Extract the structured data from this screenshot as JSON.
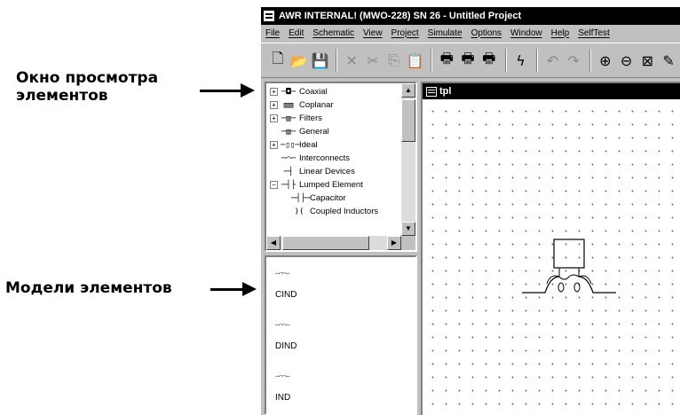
{
  "annotations": {
    "browser_label": "Окно просмотра\nэлементов",
    "models_label": "Модели элементов"
  },
  "window": {
    "title": "AWR INTERNAL! (MWO-228) SN 26 - Untitled Project"
  },
  "menu": [
    "File",
    "Edit",
    "Schematic",
    "View",
    "Project",
    "Simulate",
    "Options",
    "Window",
    "Help",
    "SelfTest"
  ],
  "toolbar": {
    "buttons": [
      {
        "icon": "new-document-icon",
        "glyph": "🗋",
        "enabled": true
      },
      {
        "icon": "open-folder-icon",
        "glyph": "📂",
        "enabled": true
      },
      {
        "icon": "save-icon",
        "glyph": "💾",
        "enabled": true
      },
      {
        "icon": "delete-icon",
        "glyph": "✕",
        "enabled": false
      },
      {
        "icon": "cut-icon",
        "glyph": "✂",
        "enabled": false
      },
      {
        "icon": "copy-icon",
        "glyph": "⎘",
        "enabled": false
      },
      {
        "icon": "paste-icon",
        "glyph": "📋",
        "enabled": true
      },
      {
        "icon": "print-icon",
        "glyph": "🖶",
        "enabled": true
      },
      {
        "icon": "print-preview-icon",
        "glyph": "🖶",
        "enabled": true
      },
      {
        "icon": "print-setup-icon",
        "glyph": "🖶",
        "enabled": true
      },
      {
        "icon": "simulate-icon",
        "glyph": "ϟ",
        "enabled": true
      },
      {
        "icon": "undo-icon",
        "glyph": "↶",
        "enabled": false
      },
      {
        "icon": "redo-icon",
        "glyph": "↷",
        "enabled": false
      },
      {
        "icon": "zoom-in-icon",
        "glyph": "⊕",
        "enabled": true
      },
      {
        "icon": "zoom-out-icon",
        "glyph": "⊖",
        "enabled": true
      },
      {
        "icon": "zoom-fit-icon",
        "glyph": "⊠",
        "enabled": true
      },
      {
        "icon": "wire-tool-icon",
        "glyph": "✎",
        "enabled": true
      }
    ]
  },
  "tree": {
    "items": [
      {
        "label": "Coaxial",
        "expander": "+",
        "glyph": "─◘─"
      },
      {
        "label": "Coplanar",
        "expander": "+",
        "glyph": "▥▥"
      },
      {
        "label": "Filters",
        "expander": "+",
        "glyph": "─▥─"
      },
      {
        "label": "General",
        "expander": "",
        "glyph": "─▥─"
      },
      {
        "label": "Ideal",
        "expander": "+",
        "glyph": "─▯▯─"
      },
      {
        "label": "Interconnects",
        "expander": "",
        "glyph": "─⌒─"
      },
      {
        "label": "Linear Devices",
        "expander": "",
        "glyph": "─┤"
      },
      {
        "label": "Lumped Element",
        "expander": "−",
        "glyph": "─┤├"
      },
      {
        "label": "Capacitor",
        "expander": "",
        "glyph": "─┤├─",
        "child": true
      },
      {
        "label": "Coupled Inductors",
        "expander": "",
        "glyph": ")(",
        "child": true
      }
    ]
  },
  "models": [
    {
      "symbol": "─⌒⌒─",
      "name": "CIND"
    },
    {
      "symbol": "─⌒⌒─",
      "name": "DIND"
    },
    {
      "symbol": "─⌒⌒─",
      "name": "IND"
    }
  ],
  "schematic": {
    "title": "tpl"
  }
}
